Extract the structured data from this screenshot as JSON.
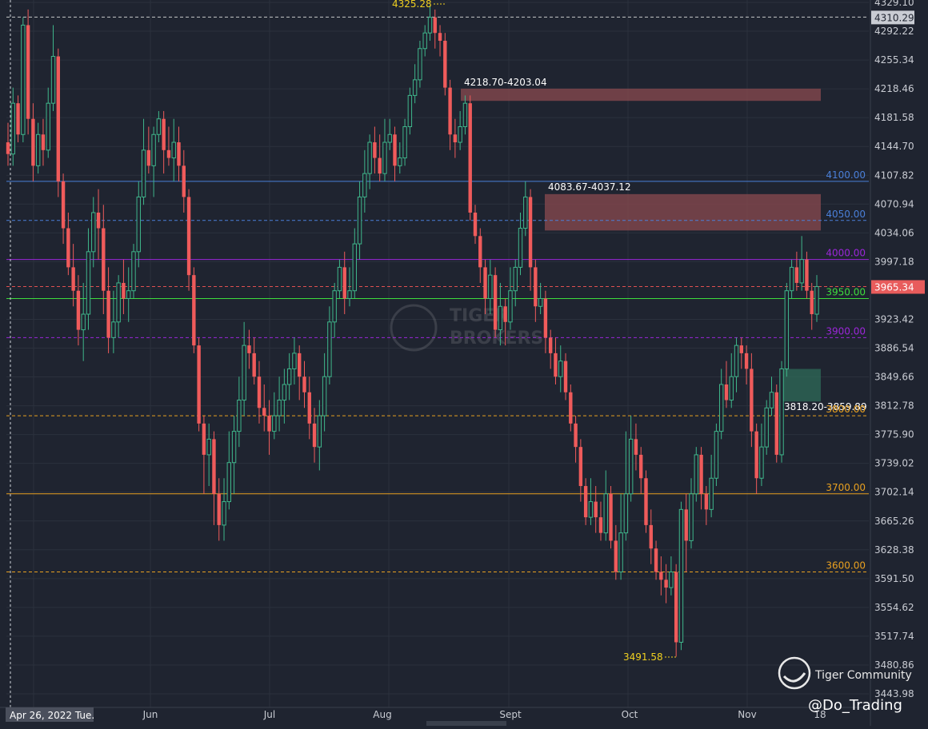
{
  "chart_data": {
    "type": "candlestick",
    "x_tick_labels": [
      "Jun",
      "Jul",
      "Aug",
      "Sept",
      "Oct",
      "Nov",
      "18"
    ],
    "y_tick_labels": [
      "4329.10",
      "4292.22",
      "4255.34",
      "4218.46",
      "4181.58",
      "4144.70",
      "4107.82",
      "4070.94",
      "4034.06",
      "3997.18",
      "3923.42",
      "3886.54",
      "3849.66",
      "3812.78",
      "3775.90",
      "3739.02",
      "3702.14",
      "3665.26",
      "3628.38",
      "3591.50",
      "3554.62",
      "3517.74",
      "3480.86",
      "3443.98"
    ],
    "ylim": [
      3430,
      4335
    ],
    "current_date_label": "Apr 26, 2022 Tue.",
    "price_tags": [
      {
        "label": "4310.29",
        "value": 4310.29,
        "style": "box-gray"
      },
      {
        "label": "3965.34",
        "value": 3965.34,
        "style": "box-red"
      }
    ],
    "levels": [
      {
        "value": 4310.29,
        "color": "#c8c8c8",
        "dash": true,
        "label": ""
      },
      {
        "value": 4100,
        "color": "#4a7fd8",
        "dash": false,
        "label": "4100.00"
      },
      {
        "value": 4050,
        "color": "#4a7fd8",
        "dash": true,
        "label": "4050.00"
      },
      {
        "value": 4000,
        "color": "#9b26d9",
        "dash": false,
        "label": "4000.00"
      },
      {
        "value": 3965.34,
        "color": "#e05050",
        "dash": true,
        "label": ""
      },
      {
        "value": 3950,
        "color": "#3ddc3d",
        "dash": false,
        "label": "3950.00"
      },
      {
        "value": 3900,
        "color": "#9b26d9",
        "dash": true,
        "label": "3900.00"
      },
      {
        "value": 3800,
        "color": "#e8a020",
        "dash": true,
        "label": "3800.00"
      },
      {
        "value": 3700,
        "color": "#e8a020",
        "dash": false,
        "label": "3700.00"
      },
      {
        "value": 3600,
        "color": "#e8a020",
        "dash": true,
        "label": "3600.00"
      }
    ],
    "zones": [
      {
        "label": "4218.70-4203.04",
        "top": 4218.7,
        "bottom": 4203.04,
        "color": "#8b4a4f"
      },
      {
        "label": "4083.67-4037.12",
        "top": 4083.67,
        "bottom": 4037.12,
        "color": "#8b4a4f"
      },
      {
        "label": "3818.20-3859.89",
        "top": 3859.89,
        "bottom": 3818.2,
        "color": "#2f6b58"
      }
    ],
    "extremes": [
      {
        "label": "4325.28",
        "value": 4325.28,
        "color": "#f0d020"
      },
      {
        "label": "3491.58",
        "value": 3491.58,
        "color": "#f0d020"
      }
    ],
    "candles": [
      [
        4150,
        4135,
        4175,
        4120
      ],
      [
        4135,
        4200,
        4220,
        4120
      ],
      [
        4200,
        4160,
        4210,
        4150
      ],
      [
        4160,
        4300,
        4310,
        4150
      ],
      [
        4300,
        4180,
        4320,
        4160
      ],
      [
        4180,
        4120,
        4200,
        4100
      ],
      [
        4120,
        4160,
        4175,
        4110
      ],
      [
        4160,
        4140,
        4180,
        4120
      ],
      [
        4140,
        4200,
        4220,
        4130
      ],
      [
        4200,
        4260,
        4300,
        4190
      ],
      [
        4260,
        4100,
        4270,
        4080
      ],
      [
        4100,
        4040,
        4110,
        4020
      ],
      [
        4040,
        3990,
        4060,
        3980
      ],
      [
        3990,
        3960,
        4020,
        3940
      ],
      [
        3960,
        3910,
        3980,
        3890
      ],
      [
        3910,
        3930,
        3970,
        3870
      ],
      [
        3930,
        4010,
        4040,
        3910
      ],
      [
        4010,
        4060,
        4080,
        3990
      ],
      [
        4060,
        4040,
        4090,
        4000
      ],
      [
        4040,
        3960,
        4070,
        3930
      ],
      [
        3960,
        3900,
        3990,
        3880
      ],
      [
        3900,
        3920,
        3960,
        3880
      ],
      [
        3920,
        3970,
        3980,
        3900
      ],
      [
        3970,
        3950,
        4000,
        3930
      ],
      [
        3950,
        3960,
        3990,
        3920
      ],
      [
        3960,
        4010,
        4020,
        3950
      ],
      [
        4010,
        4080,
        4100,
        3990
      ],
      [
        4080,
        4140,
        4180,
        4070
      ],
      [
        4140,
        4120,
        4170,
        4110
      ],
      [
        4120,
        4160,
        4170,
        4080
      ],
      [
        4160,
        4180,
        4190,
        4150
      ],
      [
        4180,
        4140,
        4190,
        4110
      ],
      [
        4140,
        4130,
        4170,
        4120
      ],
      [
        4130,
        4150,
        4180,
        4100
      ],
      [
        4150,
        4120,
        4170,
        4100
      ],
      [
        4120,
        4080,
        4140,
        4060
      ],
      [
        4080,
        3980,
        4090,
        3960
      ],
      [
        3980,
        3890,
        3990,
        3880
      ],
      [
        3890,
        3790,
        3900,
        3780
      ],
      [
        3790,
        3750,
        3800,
        3700
      ],
      [
        3750,
        3770,
        3790,
        3710
      ],
      [
        3770,
        3700,
        3780,
        3660
      ],
      [
        3700,
        3660,
        3720,
        3640
      ],
      [
        3660,
        3690,
        3720,
        3640
      ],
      [
        3690,
        3740,
        3780,
        3680
      ],
      [
        3740,
        3780,
        3800,
        3700
      ],
      [
        3780,
        3820,
        3850,
        3760
      ],
      [
        3820,
        3890,
        3920,
        3800
      ],
      [
        3890,
        3880,
        3910,
        3860
      ],
      [
        3880,
        3850,
        3900,
        3840
      ],
      [
        3850,
        3810,
        3870,
        3790
      ],
      [
        3810,
        3800,
        3840,
        3780
      ],
      [
        3800,
        3780,
        3820,
        3750
      ],
      [
        3780,
        3800,
        3830,
        3770
      ],
      [
        3800,
        3820,
        3850,
        3780
      ],
      [
        3820,
        3840,
        3860,
        3790
      ],
      [
        3840,
        3860,
        3880,
        3820
      ],
      [
        3860,
        3880,
        3900,
        3840
      ],
      [
        3880,
        3850,
        3890,
        3820
      ],
      [
        3850,
        3830,
        3870,
        3810
      ],
      [
        3830,
        3790,
        3850,
        3770
      ],
      [
        3790,
        3760,
        3810,
        3740
      ],
      [
        3760,
        3800,
        3820,
        3730
      ],
      [
        3800,
        3850,
        3880,
        3780
      ],
      [
        3850,
        3920,
        3940,
        3840
      ],
      [
        3920,
        3960,
        3970,
        3900
      ],
      [
        3960,
        3990,
        4000,
        3950
      ],
      [
        3990,
        3950,
        4010,
        3930
      ],
      [
        3950,
        3960,
        3990,
        3940
      ],
      [
        3960,
        4020,
        4040,
        3950
      ],
      [
        4020,
        4080,
        4100,
        4000
      ],
      [
        4080,
        4110,
        4140,
        4060
      ],
      [
        4110,
        4150,
        4160,
        4090
      ],
      [
        4150,
        4130,
        4170,
        4110
      ],
      [
        4130,
        4110,
        4160,
        4100
      ],
      [
        4110,
        4150,
        4180,
        4100
      ],
      [
        4150,
        4160,
        4180,
        4140
      ],
      [
        4160,
        4120,
        4170,
        4100
      ],
      [
        4120,
        4130,
        4150,
        4110
      ],
      [
        4130,
        4170,
        4180,
        4120
      ],
      [
        4170,
        4210,
        4220,
        4160
      ],
      [
        4210,
        4230,
        4250,
        4200
      ],
      [
        4230,
        4270,
        4280,
        4220
      ],
      [
        4270,
        4290,
        4300,
        4260
      ],
      [
        4290,
        4310,
        4325,
        4280
      ],
      [
        4310,
        4290,
        4320,
        4270
      ],
      [
        4290,
        4280,
        4300,
        4260
      ],
      [
        4280,
        4220,
        4290,
        4210
      ],
      [
        4220,
        4160,
        4230,
        4140
      ],
      [
        4160,
        4150,
        4180,
        4130
      ],
      [
        4150,
        4170,
        4190,
        4140
      ],
      [
        4170,
        4200,
        4210,
        4160
      ],
      [
        4200,
        4060,
        4210,
        4050
      ],
      [
        4060,
        4030,
        4070,
        4020
      ],
      [
        4030,
        3990,
        4040,
        3970
      ],
      [
        3990,
        3950,
        4000,
        3930
      ],
      [
        3950,
        3980,
        4000,
        3930
      ],
      [
        3980,
        3910,
        3990,
        3900
      ],
      [
        3910,
        3940,
        3970,
        3890
      ],
      [
        3940,
        3920,
        3950,
        3890
      ],
      [
        3920,
        3960,
        3990,
        3910
      ],
      [
        3960,
        3990,
        4000,
        3940
      ],
      [
        3990,
        4040,
        4060,
        3980
      ],
      [
        4040,
        4080,
        4100,
        4030
      ],
      [
        4080,
        3990,
        4090,
        3960
      ],
      [
        3990,
        3940,
        4000,
        3920
      ],
      [
        3940,
        3950,
        3970,
        3930
      ],
      [
        3950,
        3900,
        3960,
        3880
      ],
      [
        3900,
        3880,
        3910,
        3860
      ],
      [
        3880,
        3850,
        3900,
        3840
      ],
      [
        3850,
        3870,
        3890,
        3830
      ],
      [
        3870,
        3830,
        3880,
        3820
      ],
      [
        3830,
        3790,
        3840,
        3780
      ],
      [
        3790,
        3760,
        3800,
        3740
      ],
      [
        3760,
        3710,
        3770,
        3690
      ],
      [
        3710,
        3670,
        3720,
        3660
      ],
      [
        3670,
        3690,
        3720,
        3660
      ],
      [
        3690,
        3670,
        3710,
        3650
      ],
      [
        3670,
        3650,
        3690,
        3640
      ],
      [
        3650,
        3700,
        3730,
        3640
      ],
      [
        3700,
        3640,
        3710,
        3630
      ],
      [
        3640,
        3600,
        3660,
        3590
      ],
      [
        3600,
        3650,
        3700,
        3590
      ],
      [
        3650,
        3700,
        3780,
        3640
      ],
      [
        3700,
        3770,
        3800,
        3690
      ],
      [
        3770,
        3750,
        3790,
        3730
      ],
      [
        3750,
        3720,
        3760,
        3700
      ],
      [
        3720,
        3660,
        3730,
        3650
      ],
      [
        3660,
        3630,
        3680,
        3610
      ],
      [
        3630,
        3600,
        3640,
        3590
      ],
      [
        3600,
        3590,
        3620,
        3570
      ],
      [
        3590,
        3580,
        3610,
        3560
      ],
      [
        3580,
        3600,
        3620,
        3570
      ],
      [
        3600,
        3510,
        3610,
        3491.58
      ],
      [
        3510,
        3680,
        3690,
        3500
      ],
      [
        3680,
        3640,
        3700,
        3600
      ],
      [
        3640,
        3700,
        3720,
        3630
      ],
      [
        3700,
        3750,
        3760,
        3690
      ],
      [
        3750,
        3700,
        3760,
        3680
      ],
      [
        3700,
        3680,
        3710,
        3660
      ],
      [
        3680,
        3720,
        3750,
        3670
      ],
      [
        3720,
        3780,
        3790,
        3710
      ],
      [
        3780,
        3840,
        3860,
        3770
      ],
      [
        3840,
        3820,
        3870,
        3810
      ],
      [
        3820,
        3850,
        3880,
        3810
      ],
      [
        3850,
        3890,
        3900,
        3830
      ],
      [
        3890,
        3880,
        3900,
        3860
      ],
      [
        3880,
        3860,
        3890,
        3840
      ],
      [
        3860,
        3780,
        3880,
        3760
      ],
      [
        3780,
        3720,
        3790,
        3700
      ],
      [
        3720,
        3760,
        3790,
        3710
      ],
      [
        3760,
        3810,
        3820,
        3750
      ],
      [
        3810,
        3830,
        3850,
        3800
      ],
      [
        3830,
        3750,
        3840,
        3740
      ],
      [
        3750,
        3860,
        3870,
        3740
      ],
      [
        3860,
        3960,
        3970,
        3850
      ],
      [
        3960,
        3990,
        4000,
        3950
      ],
      [
        3990,
        3970,
        4010,
        3960
      ],
      [
        3970,
        4000,
        4030,
        3960
      ],
      [
        4000,
        3960,
        4010,
        3950
      ],
      [
        3960,
        3930,
        3970,
        3910
      ],
      [
        3930,
        3965.34,
        3980,
        3920
      ]
    ]
  },
  "watermark": {
    "brand_line1": "TIGER",
    "brand_line2": "BROKERS"
  },
  "footer": {
    "community": "Tiger Community",
    "handle": "@Do_Trading"
  }
}
